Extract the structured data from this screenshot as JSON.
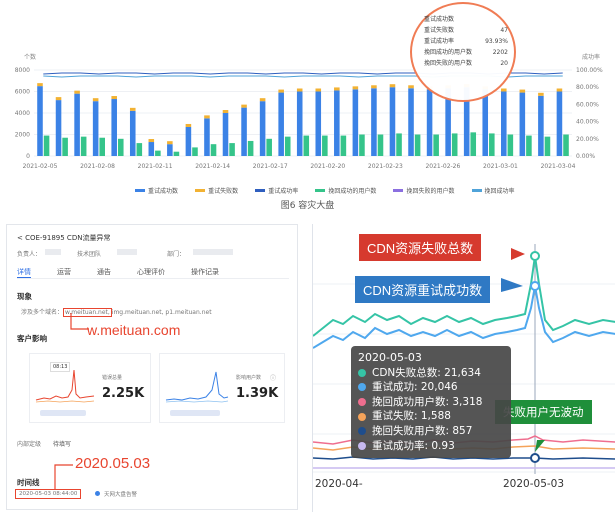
{
  "top_chart": {
    "y_left_unit": "个数",
    "y_right_unit": "成功率",
    "y_left_ticks": [
      "8000",
      "6000",
      "4000",
      "2000",
      "0"
    ],
    "y_right_ticks": [
      "100.00%",
      "80.00%",
      "60.00%",
      "40.00%",
      "20.00%",
      "0.00%"
    ],
    "x_labels": [
      "2021-02-05",
      "2021-02-08",
      "2021-02-11",
      "2021-02-14",
      "2021-02-17",
      "2021-02-20",
      "2021-02-23",
      "2021-02-26",
      "2021-03-01",
      "2021-03-04"
    ],
    "legend": [
      "重试成功数",
      "重试失败数",
      "重试成功率",
      "挽回成功的用户数",
      "挽回失败的用户数",
      "挽回成功率"
    ],
    "tooltip_rows": [
      {
        "label": "重试成功数",
        "value": ""
      },
      {
        "label": "重试失败数",
        "value": "47"
      },
      {
        "label": "重试成功率",
        "value": "93.93%"
      },
      {
        "label": "挽回成功的用户数",
        "value": "2202"
      },
      {
        "label": "挽回失败的用户数",
        "value": "20"
      }
    ],
    "caption": "图6 容灾大盘",
    "colors": {
      "blue": "#3b82e6",
      "yellow": "#f2b233",
      "green": "#35c48a",
      "purple": "#8b6fe0",
      "line": "#4fa3d9",
      "red": "#e8452f"
    }
  },
  "chart_data": {
    "type": "bar",
    "categories": [
      "2021-02-05",
      "2021-02-06",
      "2021-02-07",
      "2021-02-08",
      "2021-02-09",
      "2021-02-10",
      "2021-02-11",
      "2021-02-12",
      "2021-02-13",
      "2021-02-14",
      "2021-02-15",
      "2021-02-16",
      "2021-02-17",
      "2021-02-18",
      "2021-02-19",
      "2021-02-20",
      "2021-02-21",
      "2021-02-22",
      "2021-02-23",
      "2021-02-24",
      "2021-02-25",
      "2021-02-26",
      "2021-02-27",
      "2021-02-28",
      "2021-03-01",
      "2021-03-02",
      "2021-03-03",
      "2021-03-04",
      "2021-03-05"
    ],
    "series": [
      {
        "name": "重试成功数",
        "values": [
          6500,
          5200,
          5800,
          5100,
          5300,
          4200,
          1300,
          1100,
          2700,
          3500,
          4000,
          4500,
          5100,
          5900,
          6000,
          6000,
          6100,
          6200,
          6300,
          6400,
          6300,
          6200,
          6300,
          6400,
          6200,
          6000,
          5900,
          5600,
          6000
        ]
      },
      {
        "name": "挽回成功的用户数",
        "values": [
          1900,
          1700,
          1800,
          1700,
          1600,
          1200,
          500,
          400,
          800,
          1100,
          1200,
          1400,
          1600,
          1800,
          1900,
          1900,
          1900,
          2000,
          2000,
          2100,
          2000,
          2000,
          2100,
          2200,
          2100,
          2000,
          1900,
          1800,
          2000
        ]
      }
    ],
    "ylim": [
      0,
      8000
    ]
  },
  "left_panel": {
    "breadcrumb": "< COE-91895 CDN流量异常",
    "meta": [
      "负责人：",
      "技术团队",
      "部门："
    ],
    "tabs": [
      "详情",
      "运营",
      "通告",
      "心理评价",
      "操作记录"
    ],
    "phenomenon_title": "现象",
    "phenomenon_prefix": "涉及多个域名：",
    "domain_boxed": "w.meituan.net,",
    "domain_rest": "img.meituan.net, p1.meituan.net",
    "domain_callout": "w.meituan.com",
    "impact_title": "客户影响",
    "metric1_label": "错误总量",
    "metric1_value": "2.25K",
    "metric2_label": "影响用户数",
    "metric2_value": "1.39K",
    "mini_tag1": "08:13",
    "time_labels": [
      "内部定级",
      "待填写"
    ],
    "date_callout": "2020.05.03",
    "timeline_title": "时间线",
    "timeline_time": "2020-05-03 08:44:00",
    "timeline_event": "天网大盘告警"
  },
  "right_panel": {
    "callout_fail": "CDN资源失败总数",
    "callout_retry": "CDN资源重试成功数",
    "callout_nowave": "失败用户无波动",
    "tooltip_title": "2020-05-03",
    "tooltip_rows": [
      {
        "label": "CDN失败总数: 21,634",
        "color": "#35c4a6"
      },
      {
        "label": "重试成功: 20,046",
        "color": "#4fa8ee"
      },
      {
        "label": "挽回成功用户数: 3,318",
        "color": "#ef6e8f"
      },
      {
        "label": "重试失败: 1,588",
        "color": "#f5a35a"
      },
      {
        "label": "挽回失败用户数: 857",
        "color": "#1e4d8c"
      },
      {
        "label": "重试成功率: 0.93",
        "color": "#c7b8ef"
      }
    ],
    "x_labels": [
      "2020-04-",
      "2020-05-03"
    ]
  }
}
